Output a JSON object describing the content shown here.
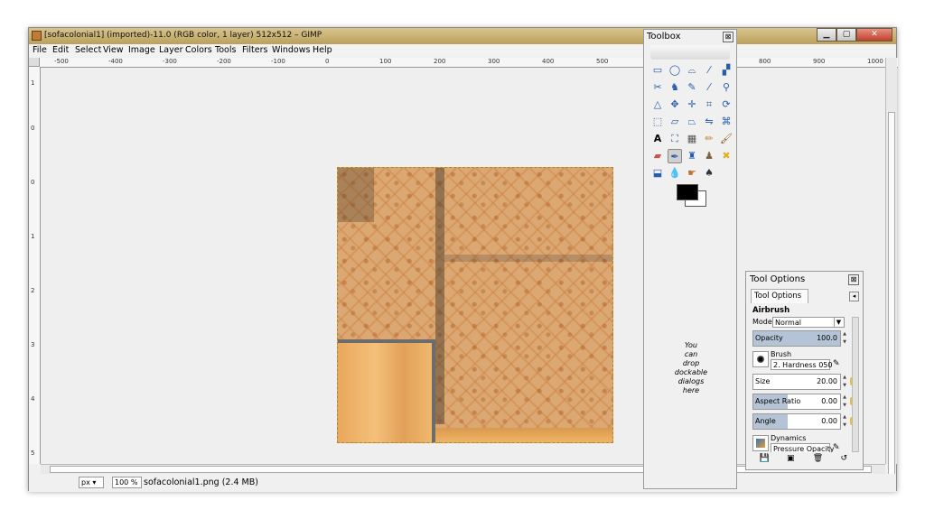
{
  "window": {
    "title": "[sofacolonial1] (imported)-11.0 (RGB color, 1 layer) 512x512 – GIMP",
    "min_label": "▁",
    "max_label": "▢",
    "close_label": "✕"
  },
  "menu": [
    "File",
    "Edit",
    "Select",
    "View",
    "Image",
    "Layer",
    "Colors",
    "Tools",
    "Filters",
    "Windows",
    "Help"
  ],
  "ruler": {
    "h_ticks": [
      "-500",
      "-400",
      "-300",
      "-200",
      "-100",
      "0",
      "100",
      "200",
      "300",
      "400",
      "500",
      "600",
      "700",
      "800",
      "900",
      "1000"
    ],
    "v_ticks": [
      "1",
      "0",
      "0",
      "1",
      "2",
      "3",
      "4",
      "5"
    ]
  },
  "status": {
    "unit": "px",
    "zoom": "100 %",
    "file": "sofacolonial1.png (2.4 MB)"
  },
  "toolbox": {
    "title": "Toolbox",
    "close": "⊠",
    "drop_hint": [
      "You",
      "can",
      "drop",
      "dockable",
      "dialogs",
      "here"
    ]
  },
  "tool_options": {
    "title": "Tool Options",
    "close": "⊠",
    "tab_label": "Tool Options",
    "tool_name": "Airbrush",
    "mode_label": "Mode:",
    "mode_value": "Normal",
    "opacity_label": "Opacity",
    "opacity_value": "100.0",
    "opacity_fraction": 1.0,
    "brush_label": "Brush",
    "brush_value": "2. Hardness 050",
    "size_label": "Size",
    "size_value": "20.00",
    "aspect_label": "Aspect Ratio",
    "aspect_value": "0.00",
    "angle_label": "Angle",
    "angle_value": "0.00",
    "dynamics_label": "Dynamics",
    "dynamics_value": "Pressure Opacity"
  }
}
